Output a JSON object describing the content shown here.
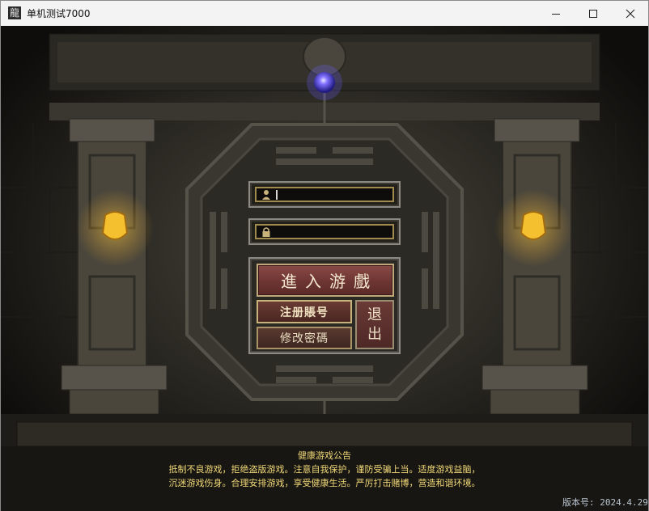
{
  "window": {
    "title": "单机测试7000",
    "icon": "app-logo-icon",
    "controls": [
      "minimize-icon",
      "maximize-icon",
      "close-icon"
    ]
  },
  "login": {
    "username_value": "",
    "password_value": "",
    "enter_label": "進入游戲",
    "register_label": "注册賬号",
    "change_password_label": "修改密碼",
    "exit_label_top": "退",
    "exit_label_bottom": "出"
  },
  "notice": {
    "title": "健康游戏公告",
    "line1": "抵制不良游戏，拒绝盗版游戏。注意自我保护，谨防受骗上当。适度游戏益脑，",
    "line2": "沉迷游戏伤身。合理安排游戏，享受健康生活。严厉打击赌博，营造和谐环境。"
  },
  "version": "版本号: 2024.4.29",
  "colors": {
    "notice_text": "#f0d878",
    "enter_button": "#7a3e3a",
    "field_border": "#a08a4e",
    "lamp_glow": "#f5c030",
    "orb": "#6a60ff"
  }
}
